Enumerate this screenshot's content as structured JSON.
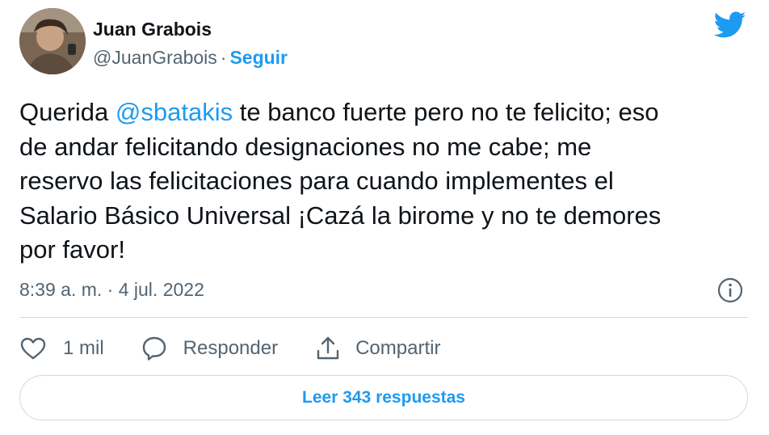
{
  "author": {
    "display_name": "Juan Grabois",
    "handle": "@JuanGrabois",
    "separator": "·",
    "follow_label": "Seguir",
    "avatar_icon": "profile-photo"
  },
  "brand": {
    "icon": "twitter-bird-icon",
    "color": "#1d9bf0"
  },
  "tweet": {
    "lines": [
      {
        "before": "Querida ",
        "mention": "@sbatakis",
        "after": " te banco fuerte pero no te felicito; eso"
      },
      {
        "text": "de andar felicitando designaciones no me cabe; me"
      },
      {
        "text": "reservo las felicitaciones para cuando implementes el"
      },
      {
        "text": "Salario Básico Universal ¡Cazá la birome y no te demores"
      },
      {
        "text": "por favor!"
      }
    ]
  },
  "meta": {
    "timestamp": "8:39 a. m. · 4 jul. 2022",
    "info_icon": "info-icon"
  },
  "actions": {
    "like_count": "1 mil",
    "reply_label": "Responder",
    "share_label": "Compartir"
  },
  "replies_button": {
    "label": "Leer 343 respuestas"
  },
  "colors": {
    "text": "#0f1419",
    "secondary": "#536471",
    "accent": "#1d9bf0",
    "border": "#cfd9de"
  }
}
